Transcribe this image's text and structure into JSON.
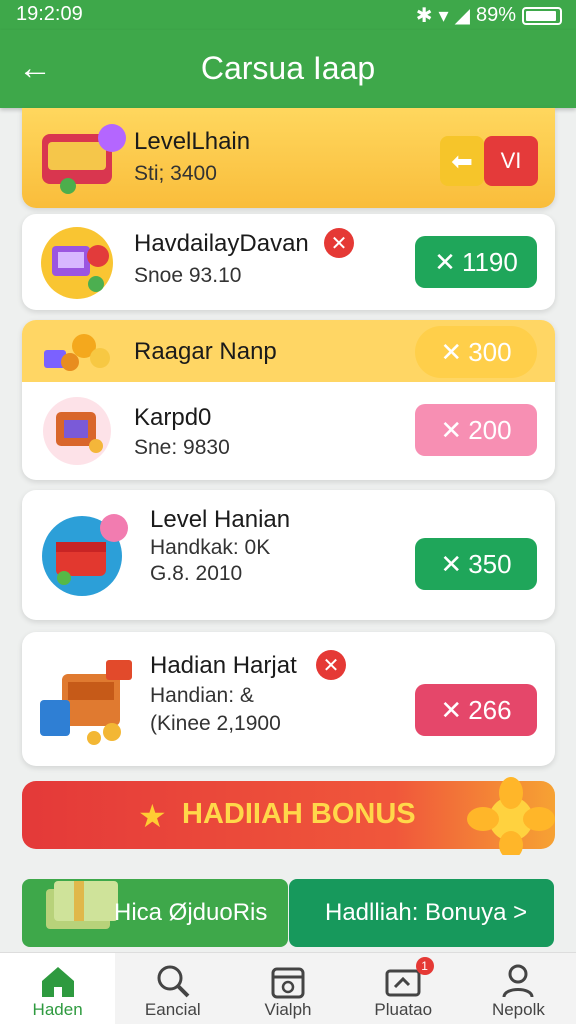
{
  "status": {
    "time": "19:2:09",
    "battery": "89%"
  },
  "header": {
    "title": "Carsua Iaap"
  },
  "items": [
    {
      "name": "LevelLhain",
      "sub": "Sti; 3400",
      "reward_a": "",
      "reward_b": "VI"
    },
    {
      "name": "HavdailayDavan",
      "sub": "Snoe 93.10",
      "reward": "1190"
    },
    {
      "name": "Raagar Nanp",
      "reward": "300"
    },
    {
      "name": "Karpd0",
      "sub": "Sne: 9830",
      "reward": "200"
    },
    {
      "name": "Level Hanian",
      "sub1": "Handkak: 0K",
      "sub2": "G.8. 2010",
      "reward": "350"
    },
    {
      "name": "Hadian Harjat",
      "sub1": "Handian: &",
      "sub2": "(Kinee 2,1900",
      "reward": "266"
    }
  ],
  "bonus": {
    "label": "HADIIAH BONUS"
  },
  "tiles": {
    "left": "Hica ØjduoRis",
    "right": "Hadlliah: Bonuya >"
  },
  "nav": [
    {
      "label": "Haden",
      "icon": "home-icon"
    },
    {
      "label": "Eancial",
      "icon": "search-icon"
    },
    {
      "label": "Vialph",
      "icon": "calendar-icon"
    },
    {
      "label": "Pluatao",
      "icon": "ticket-icon",
      "badge": "1"
    },
    {
      "label": "Nepolk",
      "icon": "person-icon"
    }
  ],
  "colors": {
    "primary": "#3ea84a",
    "green": "#1fa65a",
    "pink": "#f78fb3",
    "red": "#e5476a",
    "gold": "#ffcf4a"
  }
}
